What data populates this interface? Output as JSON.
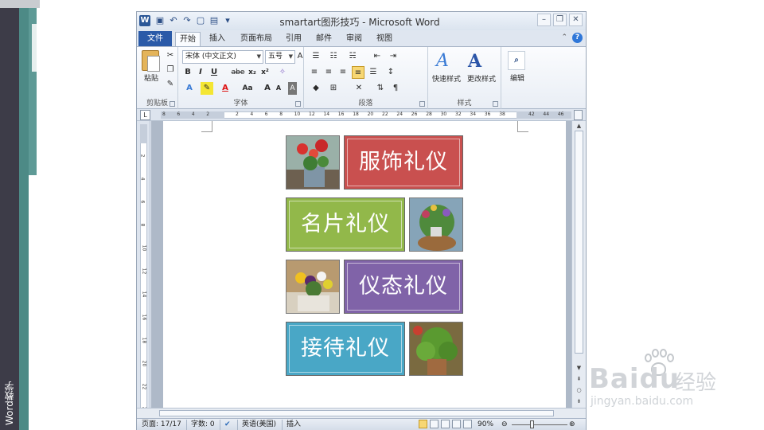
{
  "side_label": "Word教学",
  "window": {
    "title": "smartart图形技巧 - Microsoft Word",
    "app_icon": "W",
    "qat_icons": [
      "save-icon",
      "undo-icon",
      "redo-icon",
      "new-doc-icon",
      "print-preview-icon",
      "customize-qat-icon"
    ],
    "controls": [
      "minimize-icon",
      "restore-icon",
      "close-icon"
    ]
  },
  "tabs": {
    "file": "文件",
    "items": [
      {
        "label": "开始",
        "active": true
      },
      {
        "label": "插入",
        "active": false
      },
      {
        "label": "页面布局",
        "active": false
      },
      {
        "label": "引用",
        "active": false
      },
      {
        "label": "邮件",
        "active": false
      },
      {
        "label": "审阅",
        "active": false
      },
      {
        "label": "视图",
        "active": false
      }
    ]
  },
  "ribbon": {
    "clipboard": {
      "label": "剪贴板",
      "paste": "粘贴"
    },
    "font": {
      "label": "字体",
      "font_name": "宋体 (中文正文)",
      "font_size": "五号",
      "buttons": [
        "B",
        "I",
        "U",
        "abe",
        "x₂",
        "x²",
        "A",
        "A",
        "Aa",
        "A",
        "A",
        "A",
        "字"
      ]
    },
    "paragraph": {
      "label": "段落"
    },
    "styles": {
      "label": "样式",
      "quick_styles": "快速样式",
      "change_styles": "更改样式"
    },
    "editing": {
      "label": "编辑"
    }
  },
  "ruler": {
    "h_numbers": [
      "8",
      "6",
      "4",
      "2",
      "",
      "2",
      "4",
      "6",
      "8",
      "10",
      "12",
      "14",
      "16",
      "18",
      "20",
      "22",
      "24",
      "26",
      "28",
      "30",
      "32",
      "34",
      "36",
      "38",
      "",
      "42",
      "44",
      "46"
    ],
    "v_numbers": [
      "2",
      "4",
      "6",
      "8",
      "10",
      "12",
      "14",
      "16",
      "18",
      "20",
      "22",
      "24"
    ]
  },
  "smartart": {
    "tiles": [
      {
        "text": "服饰礼仪",
        "color": "#c9504f"
      },
      {
        "text": "名片礼仪",
        "color": "#92b84a"
      },
      {
        "text": "仪态礼仪",
        "color": "#8063a8"
      },
      {
        "text": "接待礼仪",
        "color": "#49a7c6"
      }
    ]
  },
  "status": {
    "page": "页面: 17/17",
    "words": "字数: 0",
    "language": "英语(美国)",
    "mode": "插入",
    "zoom": "90%"
  },
  "watermark": {
    "brand": "Bai",
    "brand_tail": "du",
    "jingyan": "经验",
    "url": "jingyan.baidu.com"
  }
}
